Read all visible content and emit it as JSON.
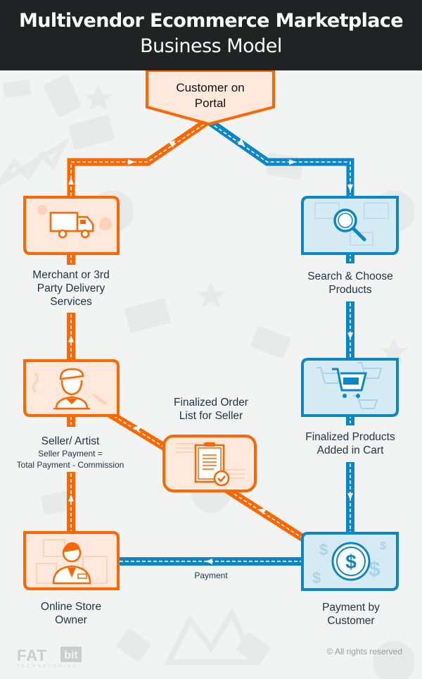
{
  "header": {
    "title_line1": "Multivendor Ecommerce Marketplace",
    "title_line2": "Business Model"
  },
  "colors": {
    "orange": "#ff6600",
    "orange_fill": "#ffe9dc",
    "blue": "#0a86c9",
    "blue_fill": "#d6eaf3",
    "header_bg": "#212224",
    "background": "#f2f3f3",
    "text": "#1f3442"
  },
  "nodes": {
    "customer_portal": {
      "line1": "Customer on",
      "line2": "Portal"
    },
    "delivery": {
      "line1": "Merchant or 3rd",
      "line2": "Party Delivery",
      "line3": "Services",
      "icon": "truck-icon"
    },
    "search": {
      "line1": "Search & Choose",
      "line2": "Products",
      "icon": "magnifier-icon"
    },
    "seller": {
      "line1": "Seller/ Artist",
      "note1": "Seller Payment =",
      "note2": "Total Payment - Commission",
      "icon": "artist-icon"
    },
    "order_list": {
      "line1": "Finalized Order",
      "line2": "List for Seller",
      "icon": "clipboard-icon"
    },
    "cart": {
      "line1": "Finalized Products",
      "line2": "Added in Cart",
      "icon": "shopping-cart-icon"
    },
    "store_owner": {
      "line1": "Online Store",
      "line2": "Owner",
      "icon": "store-owner-icon"
    },
    "payment": {
      "line1": "Payment by",
      "line2": "Customer",
      "icon": "dollar-coin-icon"
    }
  },
  "edges": {
    "payment_label": "Payment"
  },
  "footer": {
    "logo_main": "FAT",
    "logo_bit": "bit",
    "logo_sub": "TECHNOLOGIES",
    "copyright": "© All rights reserved"
  }
}
